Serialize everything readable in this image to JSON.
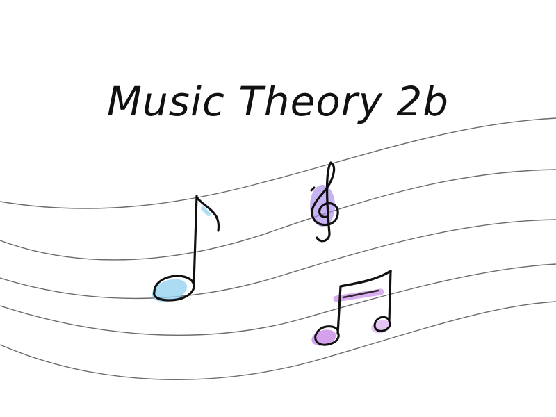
{
  "title": "Music Theory 2b",
  "colors": {
    "background": "#ffffff",
    "staff_line": "#6b6b6b",
    "ink": "#111111",
    "blue_wash": "#8fd0f0",
    "purple_wash": "#a98bea",
    "pink_wash": "#c98be8"
  },
  "icons": {
    "eighth_note": "eighth-note-icon",
    "treble_clef": "treble-clef-icon",
    "beamed_notes": "beamed-eighth-notes-icon"
  }
}
